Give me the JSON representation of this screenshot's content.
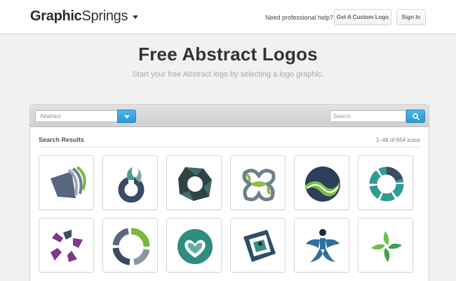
{
  "header": {
    "brand_part1": "Graphic",
    "brand_part2": "Springs",
    "help_text": "Need professional help?",
    "custom_logo_button": "Get A Custom Logo",
    "sign_in_button": "Sign In"
  },
  "hero": {
    "title": "Free Abstract Logos",
    "subtitle": "Start your free Abstract logo by selecting a logo graphic."
  },
  "filter": {
    "category_selected": "Abstract",
    "search_placeholder": "Search",
    "search_icon": "magnifier-icon"
  },
  "results": {
    "title": "Search Results",
    "count": "1–48 of 654 icons",
    "logos": [
      {
        "name": "striped-wedge-logo-icon",
        "colors": [
          "#5c6e86",
          "#78b83a"
        ]
      },
      {
        "name": "flame-ring-logo-icon",
        "colors": [
          "#3b4a66",
          "#4a9a8e"
        ]
      },
      {
        "name": "gear-blob-logo-icon",
        "colors": [
          "#3c6e6a",
          "#2e4342"
        ]
      },
      {
        "name": "clover-chain-logo-icon",
        "colors": [
          "#6d7f8c",
          "#8cbf3f"
        ]
      },
      {
        "name": "wave-sphere-logo-icon",
        "colors": [
          "#2d3e5c",
          "#7dc046"
        ]
      },
      {
        "name": "segmented-ring-logo-icon",
        "colors": [
          "#2f9b94",
          "#3c4b63"
        ]
      },
      {
        "name": "pinwheel-arrows-logo-icon",
        "colors": [
          "#7b3a8c",
          "#3c4b63"
        ]
      },
      {
        "name": "circular-arrows-logo-icon",
        "colors": [
          "#3c4b63",
          "#78b83a"
        ]
      },
      {
        "name": "heart-sphere-logo-icon",
        "colors": [
          "#2f8c80",
          "#ffffff"
        ]
      },
      {
        "name": "framed-square-logo-icon",
        "colors": [
          "#2d4e6a",
          "#3a8c86"
        ]
      },
      {
        "name": "star-person-logo-icon",
        "colors": [
          "#2f6f9a",
          "#1e2a3e"
        ]
      },
      {
        "name": "green-cross-logo-icon",
        "colors": [
          "#3fa04a",
          "#6cc04a"
        ]
      }
    ]
  }
}
